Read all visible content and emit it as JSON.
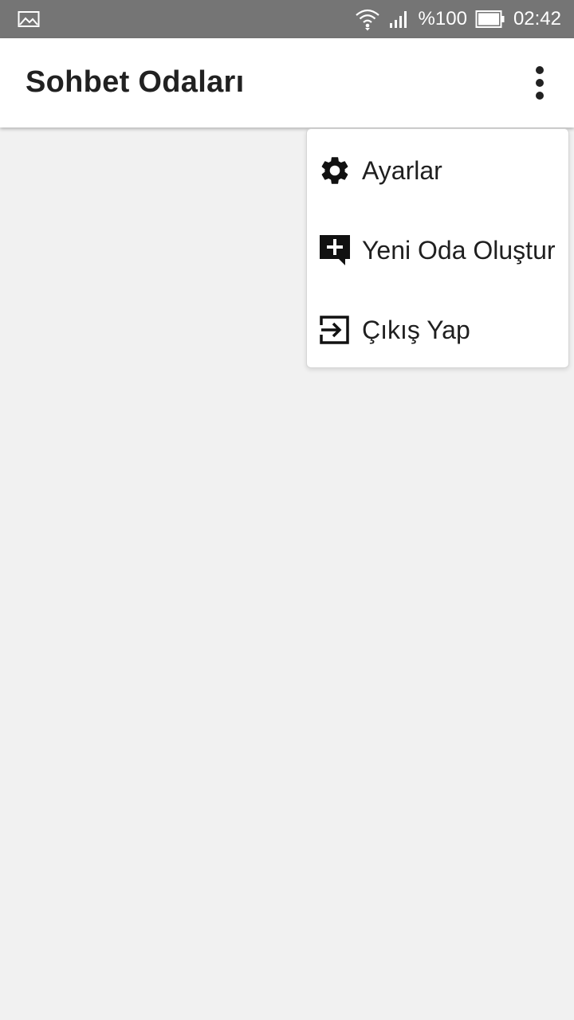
{
  "status_bar": {
    "left_icon": "image-icon",
    "wifi_icon": "wifi-icon",
    "signal_icon": "signal-icon",
    "battery_percent": "%100",
    "battery_icon": "battery-icon",
    "time": "02:42"
  },
  "app_bar": {
    "title": "Sohbet Odaları",
    "overflow_icon": "more-vert-icon"
  },
  "menu": {
    "items": [
      {
        "label": "Ayarlar",
        "icon": "gear-icon"
      },
      {
        "label": "Yeni Oda Oluştur",
        "icon": "add-comment-icon"
      },
      {
        "label": "Çıkış Yap",
        "icon": "exit-icon"
      }
    ]
  }
}
